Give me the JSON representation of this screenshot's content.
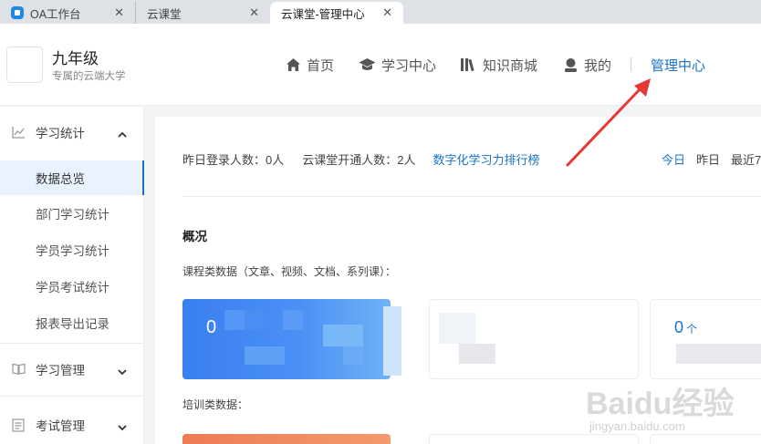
{
  "browser": {
    "tabs": [
      {
        "label": "OA工作台"
      },
      {
        "label": "云课堂"
      },
      {
        "label": "云课堂-管理中心"
      }
    ]
  },
  "header": {
    "org_name": "九年级",
    "org_subtitle": "专属的云端大学",
    "nav": [
      {
        "label": "首页",
        "icon": "home-icon"
      },
      {
        "label": "学习中心",
        "icon": "graduation-cap-icon"
      },
      {
        "label": "知识商城",
        "icon": "library-icon"
      },
      {
        "label": "我的",
        "icon": "user-icon"
      },
      {
        "label": "管理中心",
        "active": true
      }
    ]
  },
  "sidebar": {
    "groups": [
      {
        "label": "学习统计",
        "icon": "chart-icon",
        "expanded": true
      },
      {
        "label": "学习管理",
        "icon": "book-icon",
        "expanded": false
      },
      {
        "label": "考试管理",
        "icon": "exam-icon",
        "expanded": false
      }
    ],
    "items": [
      {
        "label": "数据总览",
        "active": true
      },
      {
        "label": "部门学习统计"
      },
      {
        "label": "学员学习统计"
      },
      {
        "label": "学员考试统计"
      },
      {
        "label": "报表导出记录"
      }
    ]
  },
  "main": {
    "stats": {
      "login_label": "昨日登录人数：",
      "login_value": "0人",
      "open_label": "云课堂开通人数：",
      "open_value": "2人",
      "ranking_link": "数字化学习力排行榜"
    },
    "periods": [
      "今日",
      "昨日",
      "最近7"
    ],
    "overview_title": "概况",
    "course_label": "课程类数据（文章、视频、文档、系列课）：",
    "training_label": "培训类数据：",
    "cards": {
      "blue_value": "0",
      "right_value": "0",
      "right_unit": "个"
    }
  },
  "colors": {
    "accent": "#1a73c9",
    "annotation": "#e53935",
    "card_blue": "#3a7ff0",
    "card_orange": "#ee7b54"
  },
  "watermark": {
    "brand": "Baidu经验",
    "url": "jingyan.baidu.com"
  }
}
